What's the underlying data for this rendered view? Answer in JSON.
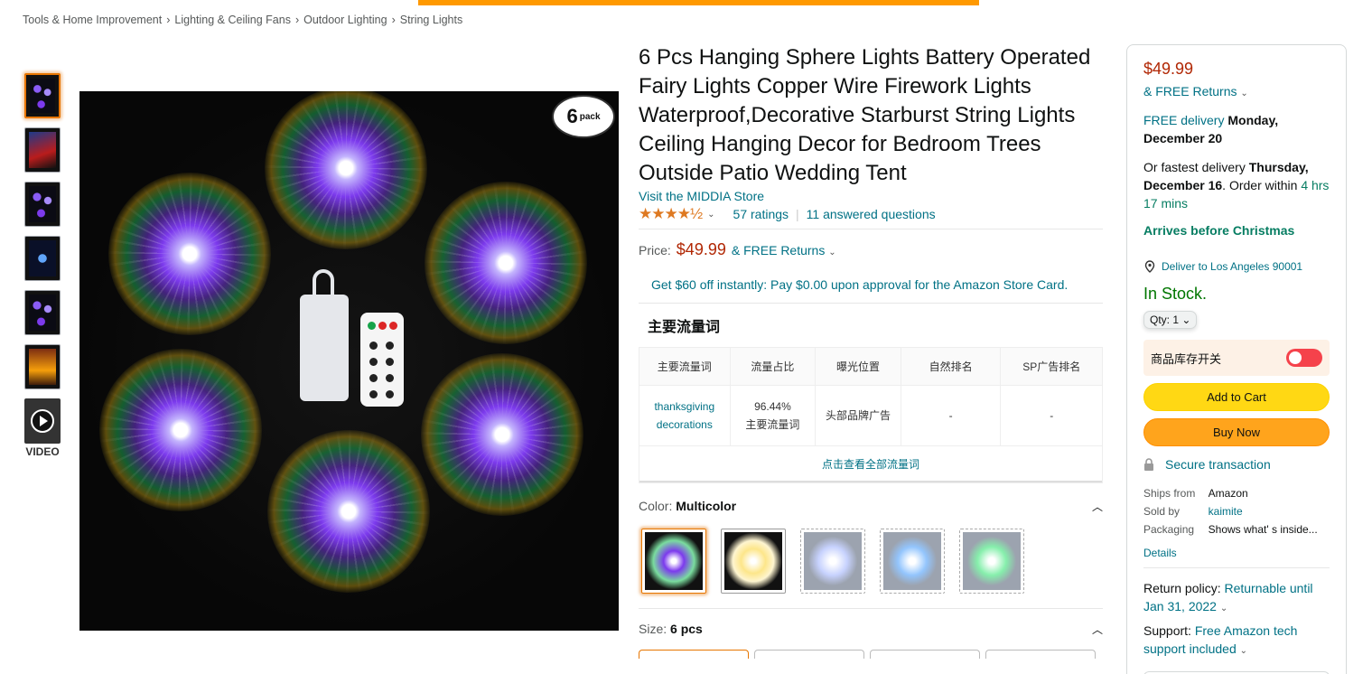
{
  "breadcrumb": [
    "Tools & Home Improvement",
    "Lighting & Ceiling Fans",
    "Outdoor Lighting",
    "String Lights"
  ],
  "gallery": {
    "video_label": "VIDEO",
    "badge_number": "6",
    "badge_text": "pack"
  },
  "product": {
    "title": "6 Pcs Hanging Sphere Lights Battery Operated Fairy Lights Copper Wire Firework Lights Waterproof,Decorative Starburst String Lights Ceiling Hanging Decor for Bedroom Trees Outside Patio Wedding Tent",
    "store_link": "Visit the MIDDIA Store",
    "stars": "★★★★½",
    "ratings": "57 ratings",
    "answered": "11 answered questions",
    "price_label": "Price:",
    "price": "$49.99",
    "returns": "& FREE Returns",
    "promo": "Get $60 off instantly: Pay $0.00 upon approval for the Amazon Store Card."
  },
  "traffic": {
    "heading": "主要流量词",
    "headers": [
      "主要流量词",
      "流量占比",
      "曝光位置",
      "自然排名",
      "SP广告排名"
    ],
    "row": {
      "keyword": "thanksgiving decorations",
      "share": "96.44%",
      "share_sub": "主要流量词",
      "position": "头部品牌广告",
      "natural": "-",
      "sp": "-"
    },
    "more": "点击查看全部流量词"
  },
  "variations": {
    "color_label": "Color:",
    "color_value": "Multicolor",
    "size_label": "Size:",
    "size_value": "6 pcs"
  },
  "buybox": {
    "price": "$49.99",
    "returns": "& FREE Returns",
    "delivery_prefix": "FREE delivery",
    "delivery_date": "Monday, December 20",
    "fast_prefix": "Or fastest delivery",
    "fast_date": "Thursday, December 16",
    "order_within": ". Order within",
    "countdown": "4 hrs 17 mins",
    "xmas": "Arrives before Christmas",
    "location": "Deliver to Los Angeles 90001",
    "stock": "In Stock.",
    "qty": "Qty: 1",
    "toggle_label": "商品库存开关",
    "add_to_cart": "Add to Cart",
    "buy_now": "Buy Now",
    "secure": "Secure transaction",
    "ships_from_k": "Ships from",
    "ships_from_v": "Amazon",
    "sold_by_k": "Sold by",
    "sold_by_v": "kaimite",
    "packaging_k": "Packaging",
    "packaging_v": "Shows what' s inside...",
    "details": "Details",
    "return_policy_k": "Return policy:",
    "return_policy_v": "Returnable until Jan 31, 2022",
    "support_k": "Support:",
    "support_v": "Free Amazon tech support included"
  },
  "colors": {
    "price": "#B12704",
    "link": "#007185",
    "stock": "#007600",
    "cart": "#FFD814",
    "buy": "#FFA41C",
    "accent": "#FF9900"
  }
}
